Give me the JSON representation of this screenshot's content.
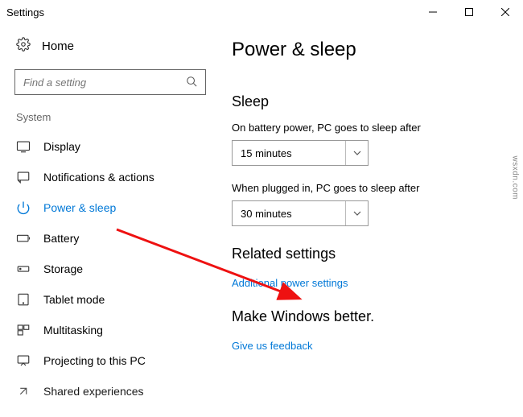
{
  "window": {
    "title": "Settings"
  },
  "sidebar": {
    "home": "Home",
    "search_placeholder": "Find a setting",
    "section_label": "System",
    "items": [
      {
        "label": "Display"
      },
      {
        "label": "Notifications & actions"
      },
      {
        "label": "Power & sleep"
      },
      {
        "label": "Battery"
      },
      {
        "label": "Storage"
      },
      {
        "label": "Tablet mode"
      },
      {
        "label": "Multitasking"
      },
      {
        "label": "Projecting to this PC"
      },
      {
        "label": "Shared experiences"
      }
    ]
  },
  "main": {
    "title": "Power & sleep",
    "sleep_heading": "Sleep",
    "battery_label": "On battery power, PC goes to sleep after",
    "battery_value": "15 minutes",
    "plugged_label": "When plugged in, PC goes to sleep after",
    "plugged_value": "30 minutes",
    "related_heading": "Related settings",
    "related_link": "Additional power settings",
    "better_heading": "Make Windows better.",
    "feedback_link": "Give us feedback"
  },
  "watermark": "wsxdn.com"
}
